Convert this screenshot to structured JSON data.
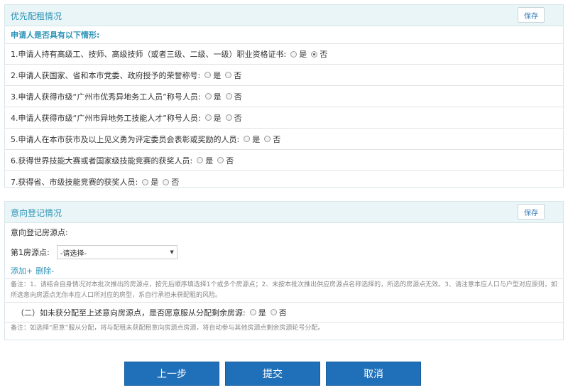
{
  "preferential": {
    "title": "优先配租情况",
    "save_label": "保存",
    "subtitle": "申请人是否具有以下情形:",
    "items": [
      {
        "text": "1.申请人持有高级工、技师、高级技师（或者三级、二级、一级）职业资格证书:",
        "selected": "否"
      },
      {
        "text": "2.申请人获国家、省和本市党委、政府授予的荣誉称号:",
        "selected": ""
      },
      {
        "text": "3.申请人获得市级“广州市优秀异地务工人员”称号人员:",
        "selected": ""
      },
      {
        "text": "4.申请人获得市级“广州市异地务工技能人才”称号人员:",
        "selected": ""
      },
      {
        "text": "5.申请人在本市获市及以上见义勇为评定委员会表彰或奖励的人员:",
        "selected": ""
      },
      {
        "text": "6.获得世界技能大赛或者国家级技能竞赛的获奖人员:",
        "selected": ""
      },
      {
        "text": "7.获得省、市级技能竞赛的获奖人员:",
        "selected": ""
      }
    ],
    "yes_label": "是",
    "no_label": "否"
  },
  "intent": {
    "title": "意向登记情况",
    "save_label": "保存",
    "source_label": "意向登记房源点:",
    "first_source_label": "第1房源点:",
    "select_value": "-请选择-",
    "add_label": "添加+",
    "delete_label": "删除-",
    "note1": "备注：1、请结合自身情况对本批次推出的房源点，按先后顺序填选择1个或多个房源点；2、未按本批次推出供应房源点名称选择的，所选的房源点无效。3、请注意本应人口与户型对应原则，如所选意向房源点无你本应人口所对应的房型，系自行承担未获配租的风险。",
    "question": "（二）如未获分配至上述意向房源点，是否愿意服从分配剩余房源:",
    "question_selected": "",
    "note2": "备注：如选择“愿意”服从分配，将与配租未获配租意向房源点房源，将自动参与其他房源点剩余房源轮号分配。"
  },
  "actions": {
    "prev": "上一步",
    "submit": "提交",
    "cancel": "取消"
  },
  "colors": {
    "accent": "#2e94b8",
    "header_bg": "#e9f5f6",
    "button_bg": "#1f6fb9"
  }
}
